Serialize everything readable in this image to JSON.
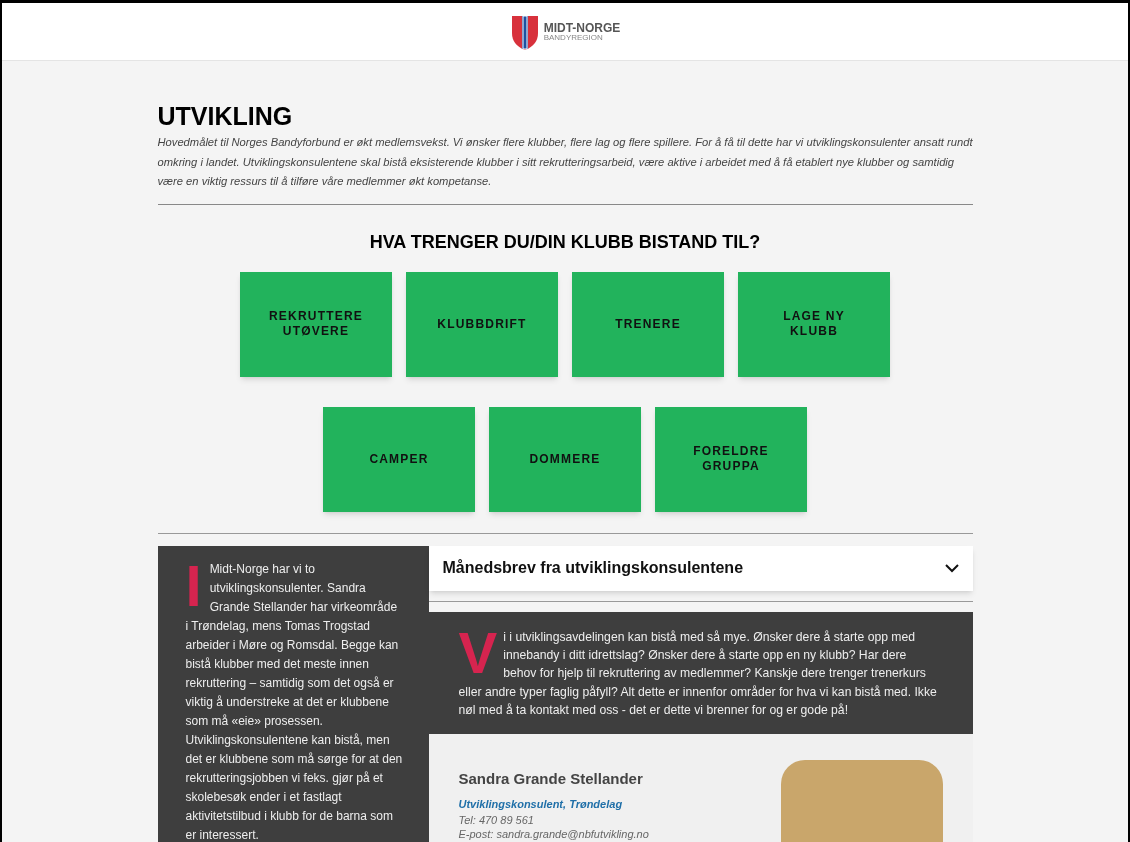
{
  "header": {
    "logo_title": "MIDT-NORGE",
    "logo_subtitle": "BANDYREGION"
  },
  "intro": {
    "title": "UTVIKLING",
    "text": "Hovedmålet til Norges Bandyforbund er økt medlemsvekst. Vi ønsker flere klubber, flere lag og flere spillere. For å få til dette har vi utviklingskonsulenter ansatt rundt omkring i landet. Utviklingskonsulentene skal bistå eksisterende klubber i sitt rekrutteringsarbeid, være aktive i arbeidet med å få etablert nye klubber og samtidig være en viktig ressurs til å tilføre våre medlemmer økt kompetanse."
  },
  "help": {
    "heading": "HVA TRENGER DU/DIN KLUBB BISTAND TIL?",
    "rows": [
      [
        "REKRUTTERE UTØVERE",
        "KLUBBDRIFT",
        "TRENERE",
        "LAGE NY KLUBB"
      ],
      [
        "CAMPER",
        "DOMMERE",
        "FORELDRE GRUPPA"
      ]
    ]
  },
  "sidebar": {
    "drop_cap": "I",
    "text": "Midt-Norge har vi to utviklingskonsulenter. Sandra Grande Stellander har virkeområde i Trøndelag, mens Tomas Trogstad arbeider i Møre og Romsdal. Begge kan bistå klubber med det meste innen rekruttering – samtidig som det også er viktig å understreke at det er klubbene som må «eie» prosessen. Utviklingskonsulentene kan bistå, men det er klubbene som må sørge for at den rekrutteringsjobben vi feks. gjør på et skolebesøk ender i et fastlagt aktivitetstilbud i klubb for de barna som er interessert."
  },
  "accordion": {
    "title": "Månedsbrev fra utviklingskonsulentene",
    "expanded": false
  },
  "callout": {
    "drop_cap": "V",
    "text": "i i utviklingsavdelingen kan bistå med så mye. Ønsker dere å starte opp med innebandy i ditt idrettslag? Ønsker dere å starte opp en ny klubb? Har dere behov for hjelp til rekruttering av medlemmer? Kanskje dere trenger trenerkurs eller andre typer faglig påfyll? Alt dette er innenfor områder for hva vi kan bistå med. Ikke nøl med å ta kontakt med oss - det er dette vi brenner for og er gode på!"
  },
  "contact": {
    "name": "Sandra Grande Stellander",
    "role": "Utviklingskonsulent, Trøndelag",
    "phone": "Tel: 470 89 561",
    "email": "E-post: sandra.grande@nbfutvikling.no"
  }
}
